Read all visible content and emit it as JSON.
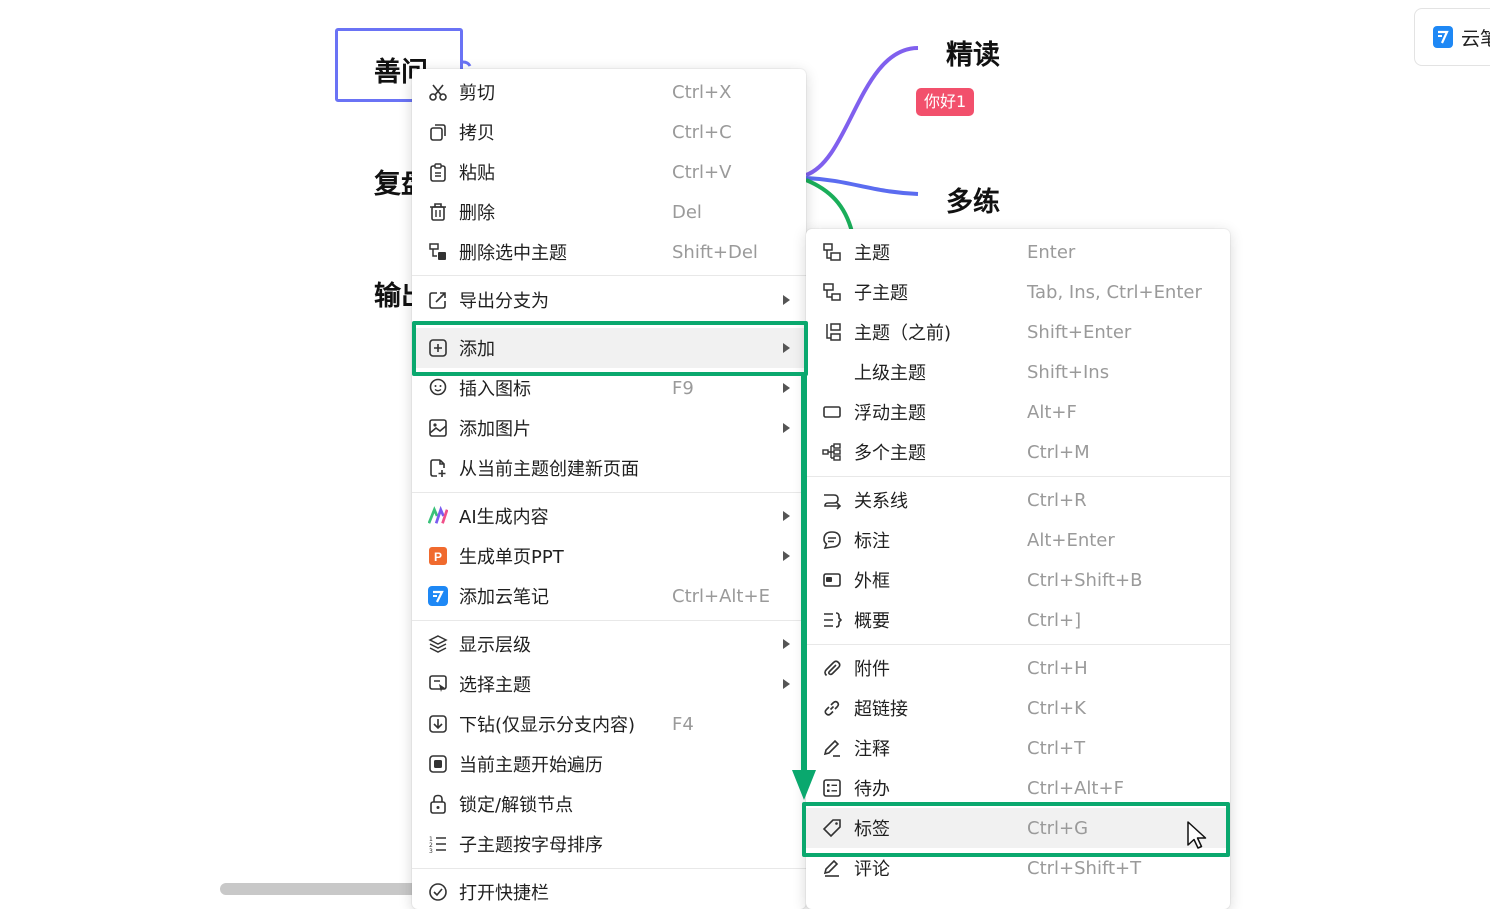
{
  "mindmap": {
    "root": "善问",
    "branch_left_2": "复盘",
    "branch_left_3": "输出",
    "right_top": "精读",
    "right_top_tag": "你好1",
    "right_mid": "多练"
  },
  "cloud_button": {
    "label": "云笔",
    "icon": "cloud-note-icon"
  },
  "main_menu": {
    "items": [
      {
        "label": "剪切",
        "shortcut": "Ctrl+X",
        "icon": "scissors-icon"
      },
      {
        "label": "拷贝",
        "shortcut": "Ctrl+C",
        "icon": "copy-icon"
      },
      {
        "label": "粘贴",
        "shortcut": "Ctrl+V",
        "icon": "paste-icon"
      },
      {
        "label": "删除",
        "shortcut": "Del",
        "icon": "trash-icon"
      },
      {
        "label": "删除选中主题",
        "shortcut": "Shift+Del",
        "icon": "delete-topic-icon"
      },
      {
        "label": "导出分支为",
        "shortcut": "",
        "icon": "export-icon"
      },
      {
        "label": "添加",
        "shortcut": "",
        "icon": "add-box-icon"
      },
      {
        "label": "插入图标",
        "shortcut": "F9",
        "icon": "emoji-icon"
      },
      {
        "label": "添加图片",
        "shortcut": "",
        "icon": "image-icon"
      },
      {
        "label": "从当前主题创建新页面",
        "shortcut": "",
        "icon": "new-page-icon"
      },
      {
        "label": "AI生成内容",
        "shortcut": "",
        "icon": "ai-icon"
      },
      {
        "label": "生成单页PPT",
        "shortcut": "",
        "icon": "ppt-icon"
      },
      {
        "label": "添加云笔记",
        "shortcut": "Ctrl+Alt+E",
        "icon": "cloud-note-icon"
      },
      {
        "label": "显示层级",
        "shortcut": "",
        "icon": "layers-icon"
      },
      {
        "label": "选择主题",
        "shortcut": "",
        "icon": "select-topic-icon"
      },
      {
        "label": "下钻(仅显示分支内容)",
        "shortcut": "F4",
        "icon": "drill-down-icon"
      },
      {
        "label": "当前主题开始遍历",
        "shortcut": "",
        "icon": "traverse-icon"
      },
      {
        "label": "锁定/解锁节点",
        "shortcut": "",
        "icon": "lock-icon"
      },
      {
        "label": "子主题按字母排序",
        "shortcut": "",
        "icon": "sort-icon"
      },
      {
        "label": "打开快捷栏",
        "shortcut": "",
        "icon": "check-circle-icon"
      }
    ]
  },
  "sub_menu": {
    "items": [
      {
        "label": "主题",
        "shortcut": "Enter",
        "icon": "topic-icon"
      },
      {
        "label": "子主题",
        "shortcut": "Tab, Ins, Ctrl+Enter",
        "icon": "subtopic-icon"
      },
      {
        "label": "主题（之前)",
        "shortcut": "Shift+Enter",
        "icon": "topic-before-icon"
      },
      {
        "label": "上级主题",
        "shortcut": "Shift+Ins",
        "icon": ""
      },
      {
        "label": "浮动主题",
        "shortcut": "Alt+F",
        "icon": "floating-topic-icon"
      },
      {
        "label": "多个主题",
        "shortcut": "Ctrl+M",
        "icon": "multi-topic-icon"
      },
      {
        "label": "关系线",
        "shortcut": "Ctrl+R",
        "icon": "relation-line-icon"
      },
      {
        "label": "标注",
        "shortcut": "Alt+Enter",
        "icon": "callout-icon"
      },
      {
        "label": "外框",
        "shortcut": "Ctrl+Shift+B",
        "icon": "boundary-icon"
      },
      {
        "label": "概要",
        "shortcut": "Ctrl+]",
        "icon": "summary-icon"
      },
      {
        "label": "附件",
        "shortcut": "Ctrl+H",
        "icon": "attachment-icon"
      },
      {
        "label": "超链接",
        "shortcut": "Ctrl+K",
        "icon": "link-icon"
      },
      {
        "label": "注释",
        "shortcut": "Ctrl+T",
        "icon": "note-icon"
      },
      {
        "label": "待办",
        "shortcut": "Ctrl+Alt+F",
        "icon": "todo-icon"
      },
      {
        "label": "标签",
        "shortcut": "Ctrl+G",
        "icon": "tag-icon"
      },
      {
        "label": "评论",
        "shortcut": "Ctrl+Shift+T",
        "icon": "comment-icon"
      }
    ]
  },
  "colors": {
    "highlight": "#0aa86e",
    "branch_purple": "#8060ee",
    "branch_blue": "#5b6cf0",
    "branch_green": "#1aae5a",
    "tag_bg": "#f2506c"
  }
}
